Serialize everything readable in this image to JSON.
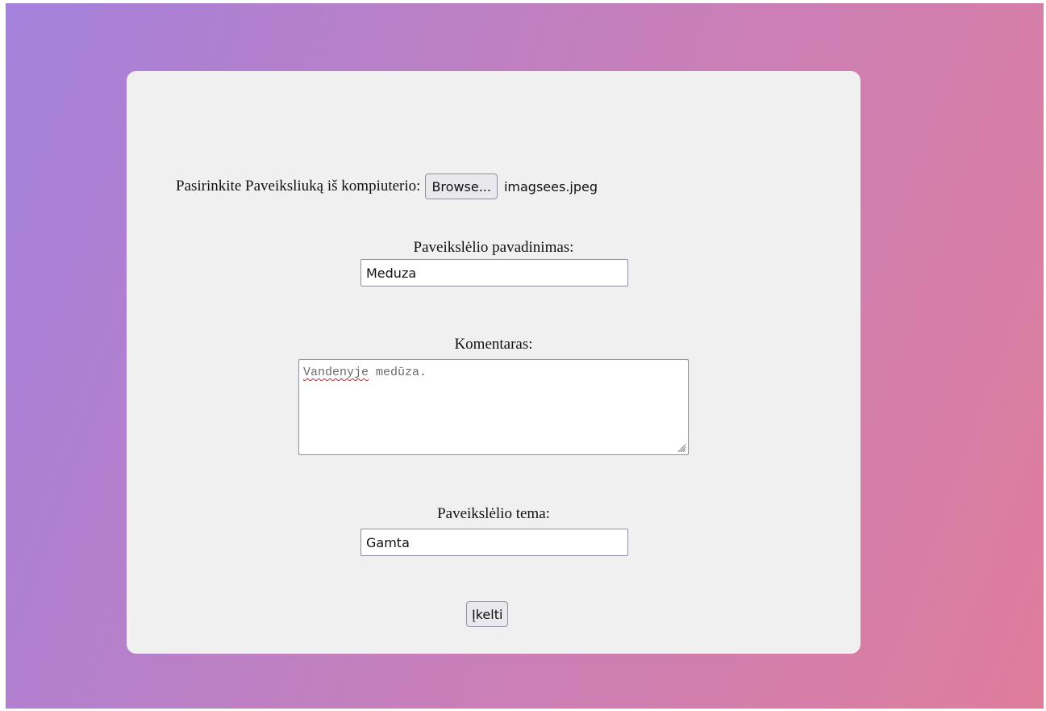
{
  "form": {
    "file": {
      "label": "Pasirinkite Paveiksliuką iš kompiuterio:",
      "browse_label": "Browse...",
      "file_name": "imagsees.jpeg"
    },
    "title": {
      "label": "Paveikslėlio pavadinimas:",
      "value": "Meduza"
    },
    "comment": {
      "label": "Komentaras:",
      "misspelled_word": "Vandenyje",
      "rest": " medūza."
    },
    "theme": {
      "label": "Paveikslėlio tema:",
      "value": "Gamta"
    },
    "submit_label": "Įkelti"
  },
  "colors": {
    "gradient_start": "#a481dc",
    "gradient_mid": "#c97fb8",
    "gradient_end": "#df7d9c",
    "card_background": "#f0f0f0",
    "spellcheck_underline": "#d81b1b"
  }
}
